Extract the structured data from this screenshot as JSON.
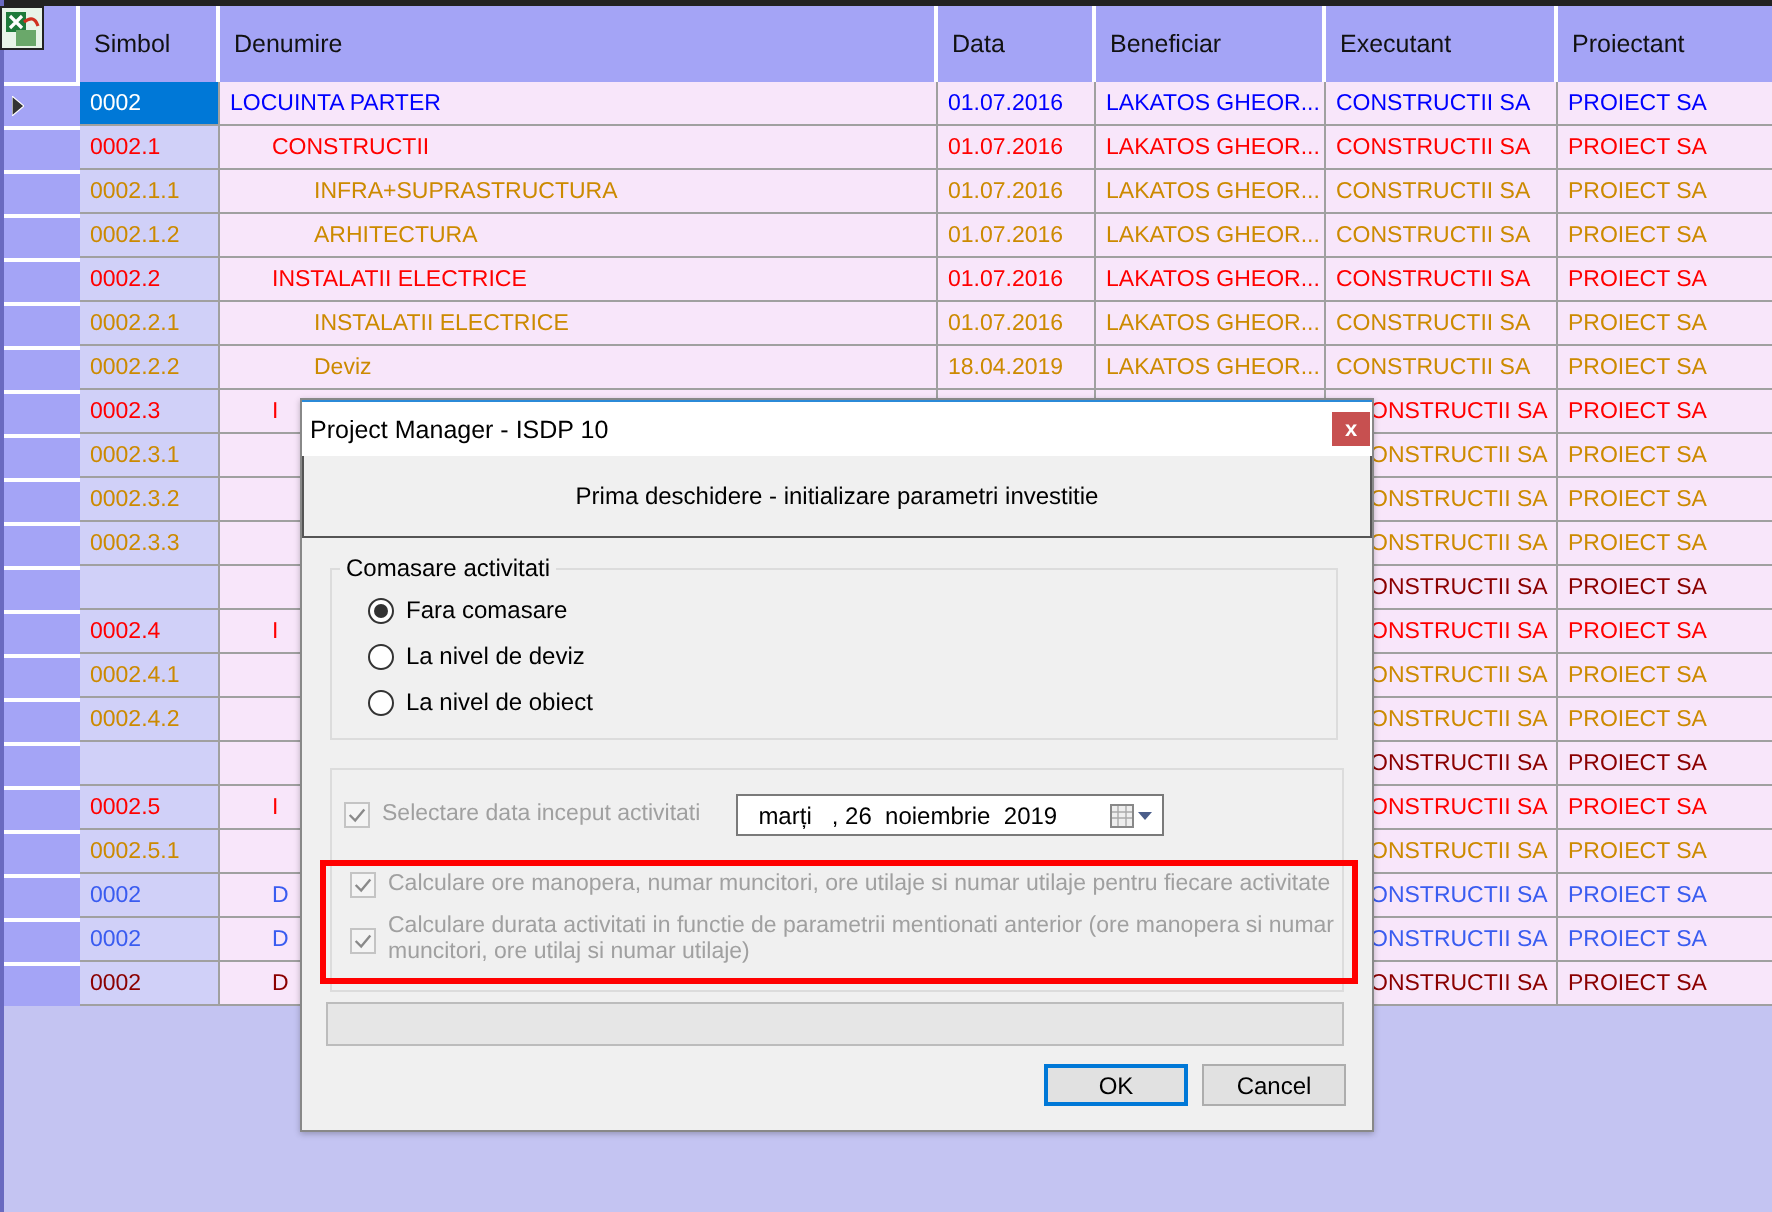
{
  "table": {
    "columns": [
      "Simbol",
      "Denumire",
      "Data",
      "Beneficiar",
      "Executant",
      "Proiectant"
    ],
    "rows": [
      {
        "simbol": "0002",
        "denumire": "LOCUINTA PARTER",
        "data": "01.07.2016",
        "beneficiar": "LAKATOS GHEOR...",
        "executant": "CONSTRUCTII SA",
        "proiectant": "PROIECT SA",
        "color": "#0000ff",
        "selected": true,
        "children": [
          {
            "simbol": "0002.1",
            "denumire": "CONSTRUCTII",
            "data": "01.07.2016",
            "beneficiar": "LAKATOS GHEOR...",
            "executant": "CONSTRUCTII SA",
            "proiectant": "PROIECT SA",
            "color": "#ff0000",
            "selected": false,
            "children": [
              {
                "simbol": "0002.1.1",
                "denumire": "INFRA+SUPRASTRUCTURA",
                "data": "01.07.2016",
                "beneficiar": "LAKATOS GHEOR...",
                "executant": "CONSTRUCTII SA",
                "proiectant": "PROIECT SA",
                "color": "#cc8a00",
                "selected": false
              },
              {
                "simbol": "0002.1.2",
                "denumire": "ARHITECTURA",
                "data": "01.07.2016",
                "beneficiar": "LAKATOS GHEOR...",
                "executant": "CONSTRUCTII SA",
                "proiectant": "PROIECT SA",
                "color": "#cc8a00",
                "selected": false
              }
            ]
          },
          {
            "simbol": "0002.2",
            "denumire": "INSTALATII ELECTRICE",
            "data": "01.07.2016",
            "beneficiar": "LAKATOS GHEOR...",
            "executant": "CONSTRUCTII SA",
            "proiectant": "PROIECT SA",
            "color": "#ff0000",
            "selected": false,
            "children": [
              {
                "simbol": "0002.2.1",
                "denumire": "INSTALATII ELECTRICE",
                "data": "01.07.2016",
                "beneficiar": "LAKATOS GHEOR...",
                "executant": "CONSTRUCTII SA",
                "proiectant": "PROIECT SA",
                "color": "#cc8a00",
                "selected": false
              },
              {
                "simbol": "0002.2.2",
                "denumire": "Deviz",
                "data": "18.04.2019",
                "beneficiar": "LAKATOS GHEOR...",
                "executant": "CONSTRUCTII SA",
                "proiectant": "PROIECT SA",
                "color": "#cc8a00",
                "selected": false
              }
            ]
          },
          {
            "simbol": "0002.3",
            "denumire": "I",
            "executant": "ONSTRUCTII SA",
            "proiectant": "PROIECT SA",
            "color": "#ff0000",
            "selected": false,
            "children": [
              {
                "simbol": "0002.3.1",
                "executant": "ONSTRUCTII SA",
                "proiectant": "PROIECT SA",
                "color": "#cc8a00",
                "selected": false
              },
              {
                "simbol": "0002.3.2",
                "executant": "ONSTRUCTII SA",
                "proiectant": "PROIECT SA",
                "color": "#cc8a00",
                "selected": false
              },
              {
                "simbol": "0002.3.3",
                "executant": "ONSTRUCTII SA",
                "proiectant": "PROIECT SA",
                "color": "#cc8a00",
                "selected": false
              },
              {
                "executant": "ONSTRUCTII SA",
                "proiectant": "PROIECT SA",
                "color": "#8b0000",
                "selected": false
              }
            ]
          },
          {
            "simbol": "0002.4",
            "denumire": "I",
            "executant": "ONSTRUCTII SA",
            "proiectant": "PROIECT SA",
            "color": "#ff0000",
            "selected": false,
            "children": [
              {
                "simbol": "0002.4.1",
                "executant": "ONSTRUCTII SA",
                "proiectant": "PROIECT SA",
                "color": "#cc8a00",
                "selected": false
              },
              {
                "simbol": "0002.4.2",
                "executant": "ONSTRUCTII SA",
                "proiectant": "PROIECT SA",
                "color": "#cc8a00",
                "selected": false
              },
              {
                "executant": "ONSTRUCTII SA",
                "proiectant": "PROIECT SA",
                "color": "#8b0000",
                "selected": false
              }
            ]
          },
          {
            "simbol": "0002.5",
            "denumire": "I",
            "executant": "ONSTRUCTII SA",
            "proiectant": "PROIECT SA",
            "color": "#ff0000",
            "selected": false,
            "children": [
              {
                "simbol": "0002.5.1",
                "executant": "ONSTRUCTII SA",
                "proiectant": "PROIECT SA",
                "color": "#cc8a00",
                "selected": false
              }
            ]
          },
          {
            "simbol": "0002",
            "denumire": "D",
            "executant": "ONSTRUCTII SA",
            "proiectant": "PROIECT SA",
            "color": "#3a5cf0",
            "selected": false
          },
          {
            "simbol": "0002",
            "denumire": "D",
            "executant": "ONSTRUCTII SA",
            "proiectant": "PROIECT SA",
            "color": "#3a5cf0",
            "selected": false
          },
          {
            "simbol": "0002",
            "denumire": "D",
            "executant": "ONSTRUCTII SA",
            "proiectant": "PROIECT SA",
            "color": "#8b0000",
            "selected": false
          }
        ]
      }
    ]
  },
  "dialog": {
    "title": "Project Manager - ISDP 10",
    "close": "x",
    "heading": "Prima deschidere - initializare parametri investitie",
    "merge_group": {
      "title": "Comasare activitati",
      "options": [
        {
          "label": "Fara comasare",
          "selected": true
        },
        {
          "label": "La nivel de deviz",
          "selected": false
        },
        {
          "label": "La nivel de obiect",
          "selected": false
        }
      ]
    },
    "start_date": {
      "label": "Selectare data inceput activitati",
      "checked": true,
      "disabled": true,
      "value": "marți   , 26  noiembrie  2019"
    },
    "options": [
      {
        "label": "Calculare ore manopera, numar muncitori, ore utilaje si numar utilaje pentru fiecare activitate",
        "checked": true,
        "disabled": true
      },
      {
        "label": "Calculare durata activitati in functie de parametrii mentionati anterior (ore manopera si numar muncitori, ore utilaj si numar utilaje)",
        "checked": true,
        "disabled": true
      }
    ],
    "progress": {
      "level": 0
    },
    "buttons": [
      {
        "label": "OK",
        "default": true
      },
      {
        "label": "Cancel",
        "default": false
      }
    ]
  }
}
